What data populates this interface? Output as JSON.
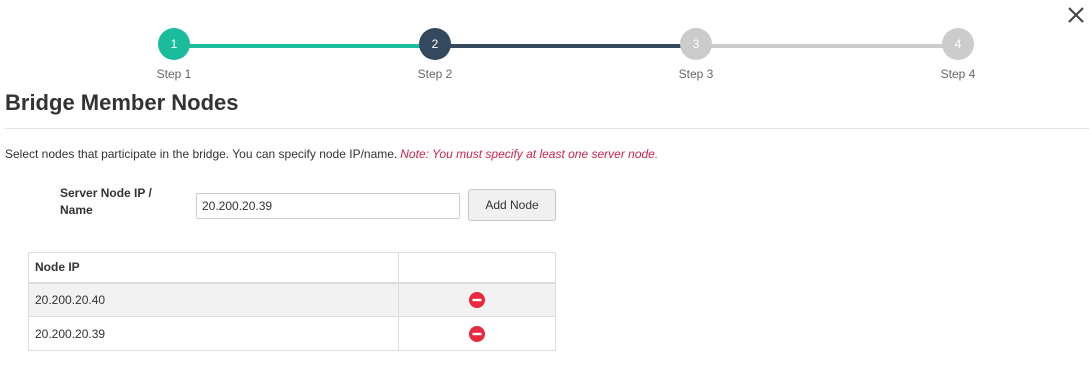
{
  "dialog": {
    "close_icon": "close-icon"
  },
  "stepper": {
    "steps": [
      {
        "number": "1",
        "label": "Step 1",
        "state": "completed",
        "color": "#1abc9c"
      },
      {
        "number": "2",
        "label": "Step 2",
        "state": "active",
        "color": "#34495e"
      },
      {
        "number": "3",
        "label": "Step 3",
        "state": "pending",
        "color": "#cccccc"
      },
      {
        "number": "4",
        "label": "Step 4",
        "state": "pending",
        "color": "#cccccc"
      }
    ],
    "line_colors": [
      "#1abc9c",
      "#34495e",
      "#cccccc"
    ]
  },
  "page": {
    "title": "Bridge Member Nodes",
    "description": "Select nodes that participate in the bridge. You can specify node IP/name.",
    "note": "Note: You must specify at least one server node."
  },
  "form": {
    "label": "Server Node IP / Name",
    "input_value": "20.200.20.39",
    "add_button": "Add Node"
  },
  "table": {
    "headers": [
      "Node IP",
      ""
    ],
    "rows": [
      {
        "ip": "20.200.20.40",
        "action_icon": "remove-icon"
      },
      {
        "ip": "20.200.20.39",
        "action_icon": "remove-icon"
      }
    ]
  },
  "colors": {
    "remove": "#e8283c",
    "note": "#c7254e"
  }
}
